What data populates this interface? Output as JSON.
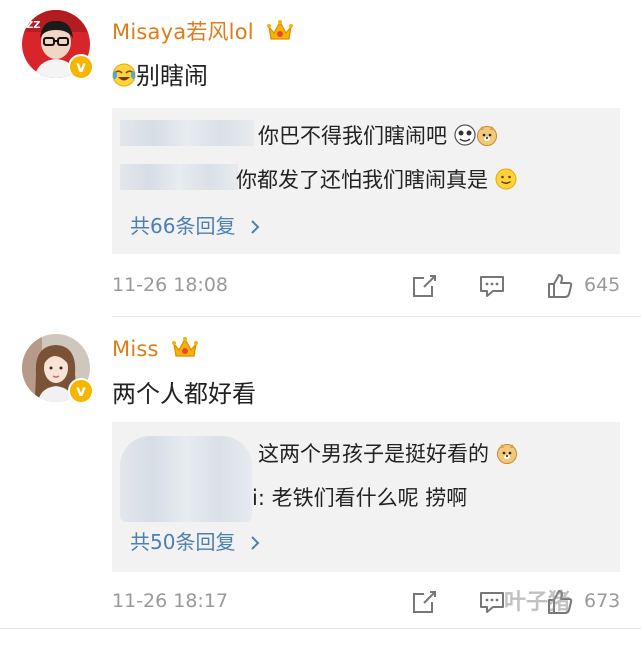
{
  "comments": [
    {
      "username": "Misaya若风lol",
      "text": "别瞎闹",
      "replies": [
        {
          "text": "你巴不得我们瞎闹吧"
        },
        {
          "text": "你都发了还怕我们瞎闹真是"
        }
      ],
      "more_replies": "共66条回复",
      "timestamp": "11-26 18:08",
      "likes": "645"
    },
    {
      "username": "Miss",
      "text": "两个人都好看",
      "replies": [
        {
          "text": "这两个男孩子是挺好看的"
        },
        {
          "text": "i: 老铁们看什么呢  捞啊"
        }
      ],
      "more_replies": "共50条回复",
      "timestamp": "11-26 18:17",
      "likes": "673"
    }
  ],
  "watermark": "叶子猪",
  "icons": {
    "verified": "verified-badge-icon",
    "crown": "crown-icon",
    "share": "share-icon",
    "reply": "comment-icon",
    "like": "thumbs-up-icon",
    "chevron": "chevron-right-icon"
  },
  "colors": {
    "username": "#e07b1a",
    "link": "#4d7fb0",
    "meta": "#9a9a9a",
    "reply_bg": "#f2f2f2",
    "verified": "#f7b500"
  }
}
